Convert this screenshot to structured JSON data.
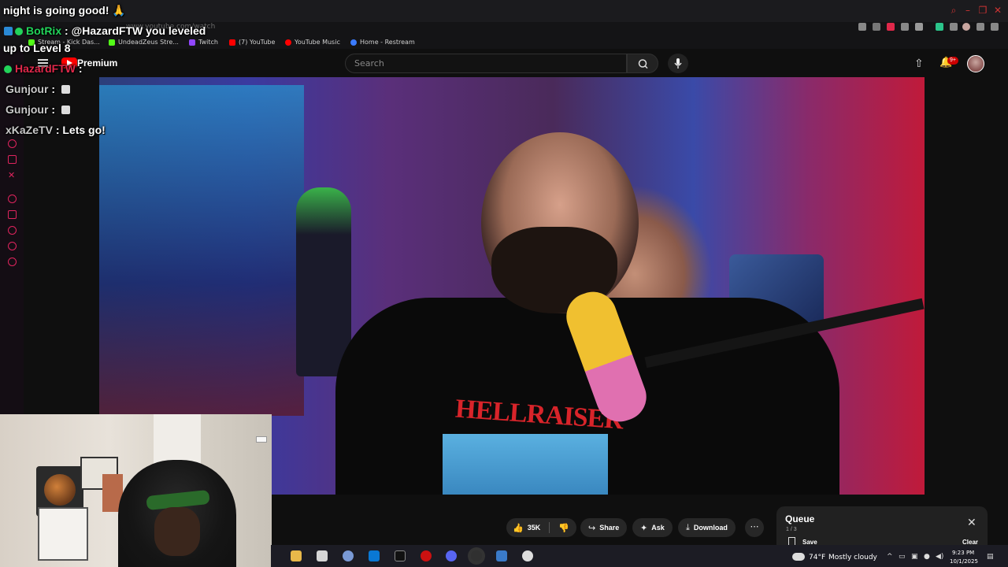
{
  "browser": {
    "url": "www.youtube.com/watch",
    "window_controls": [
      "–",
      "❐",
      "✕"
    ],
    "bookmarks": [
      {
        "label": "Stream - Kick Das...",
        "color": "#53fc18"
      },
      {
        "label": "UndeadZeus Stre...",
        "color": "#53fc18"
      },
      {
        "label": "Twitch",
        "color": "#9146ff"
      },
      {
        "label": "(7) YouTube",
        "color": "#ff0000"
      },
      {
        "label": "YouTube Music",
        "color": "#ff0000"
      },
      {
        "label": "Home - Restream",
        "color": "#3b7bff"
      }
    ]
  },
  "youtube": {
    "premium_label": "Premium",
    "search_placeholder": "Search",
    "notification_badge": "9+",
    "actions": {
      "like_count": "35K",
      "share": "Share",
      "ask": "Ask",
      "download": "Download",
      "more": "⋯"
    },
    "queue": {
      "title": "Queue",
      "count": "1 / 3",
      "save": "Save",
      "clear": "Clear"
    },
    "video_shirt_text": "HELLRAISER"
  },
  "chat": [
    {
      "user": "",
      "message": "night is going good! 🙏"
    },
    {
      "user": "BotRix",
      "message": ": @HazardFTW you leveled"
    },
    {
      "user": "",
      "message": "up to Level 8"
    },
    {
      "user": "HazardFTW",
      "message": ":"
    },
    {
      "user": "Gunjour",
      "message": ":"
    },
    {
      "user": "Gunjour",
      "message": ":"
    },
    {
      "user": "xKaZeTV",
      "message": ": Lets go!"
    }
  ],
  "taskbar": {
    "weather_temp": "74°F",
    "weather_condition": "Mostly cloudy",
    "time": "9:23 PM",
    "date": "10/1/2025"
  },
  "colors": {
    "accent_red": "#ff0000",
    "chat_green": "#22d35a",
    "chat_red": "#e0284a"
  }
}
